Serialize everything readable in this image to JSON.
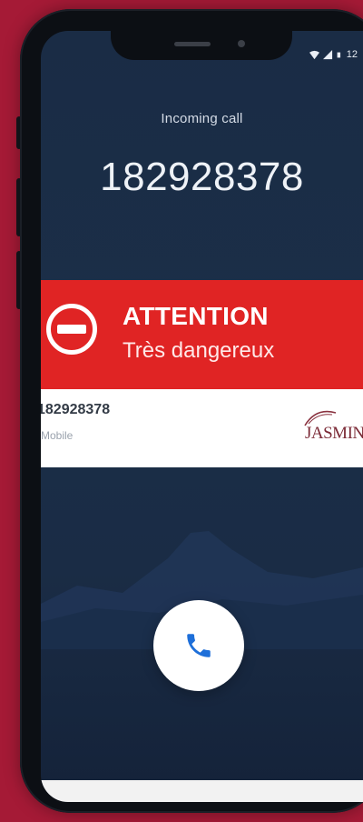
{
  "status_bar": {
    "time": "12",
    "icons": [
      "wifi-icon",
      "signal-icon",
      "battery-icon"
    ]
  },
  "call": {
    "label": "Incoming call",
    "number": "182928378"
  },
  "alert": {
    "title": "ATTENTION",
    "subtitle": "Très dangereux",
    "icon": "no-entry-icon",
    "color": "#e02424"
  },
  "caller_card": {
    "number": "182928378",
    "type": "Mobile",
    "brand": "JASMIN"
  },
  "actions": {
    "answer_icon": "phone-icon",
    "answer_icon_color": "#1e6fd9"
  },
  "colors": {
    "background": "#a51a36",
    "screen": "#1b2e48"
  }
}
